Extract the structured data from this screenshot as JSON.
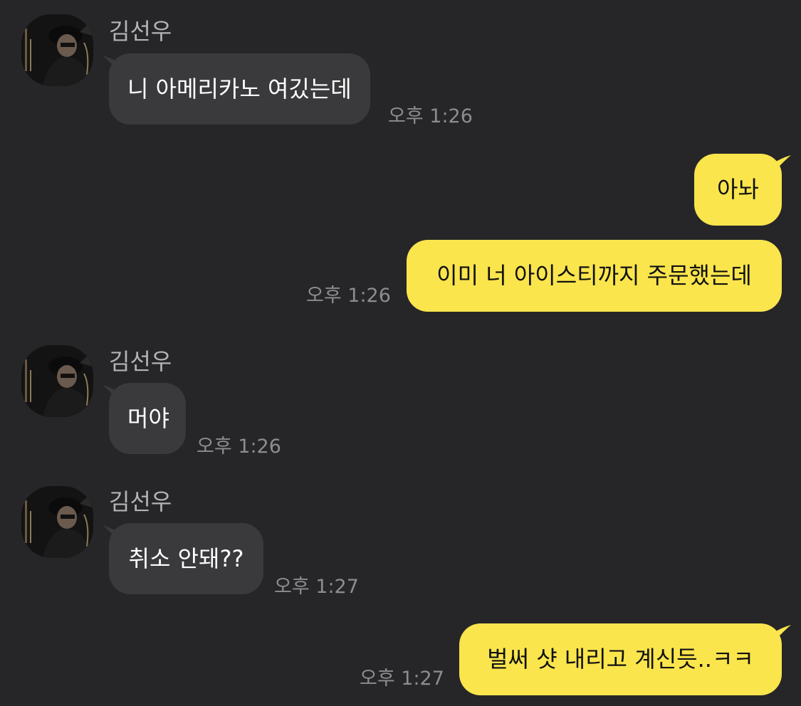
{
  "colors": {
    "background": "#262628",
    "incoming_bubble": "#3a3a3c",
    "outgoing_bubble": "#fae54d",
    "sender_name": "#b4b4b6",
    "timestamp": "#8d8d90"
  },
  "messages": [
    {
      "sender": "김선우",
      "text": "니 아메리카노 여깄는데",
      "time": "오후 1:26"
    },
    {
      "text": "아놔"
    },
    {
      "text": "이미 너 아이스티까지 주문했는데",
      "time": "오후 1:26"
    },
    {
      "sender": "김선우",
      "text": "머야",
      "time": "오후 1:26"
    },
    {
      "sender": "김선우",
      "text": "취소 안돼??",
      "time": "오후 1:27"
    },
    {
      "text": "벌써 샷 내리고 계신듯..ㅋㅋ",
      "time": "오후 1:27"
    }
  ],
  "icons": {
    "avatar": "profile-photo-icon"
  }
}
